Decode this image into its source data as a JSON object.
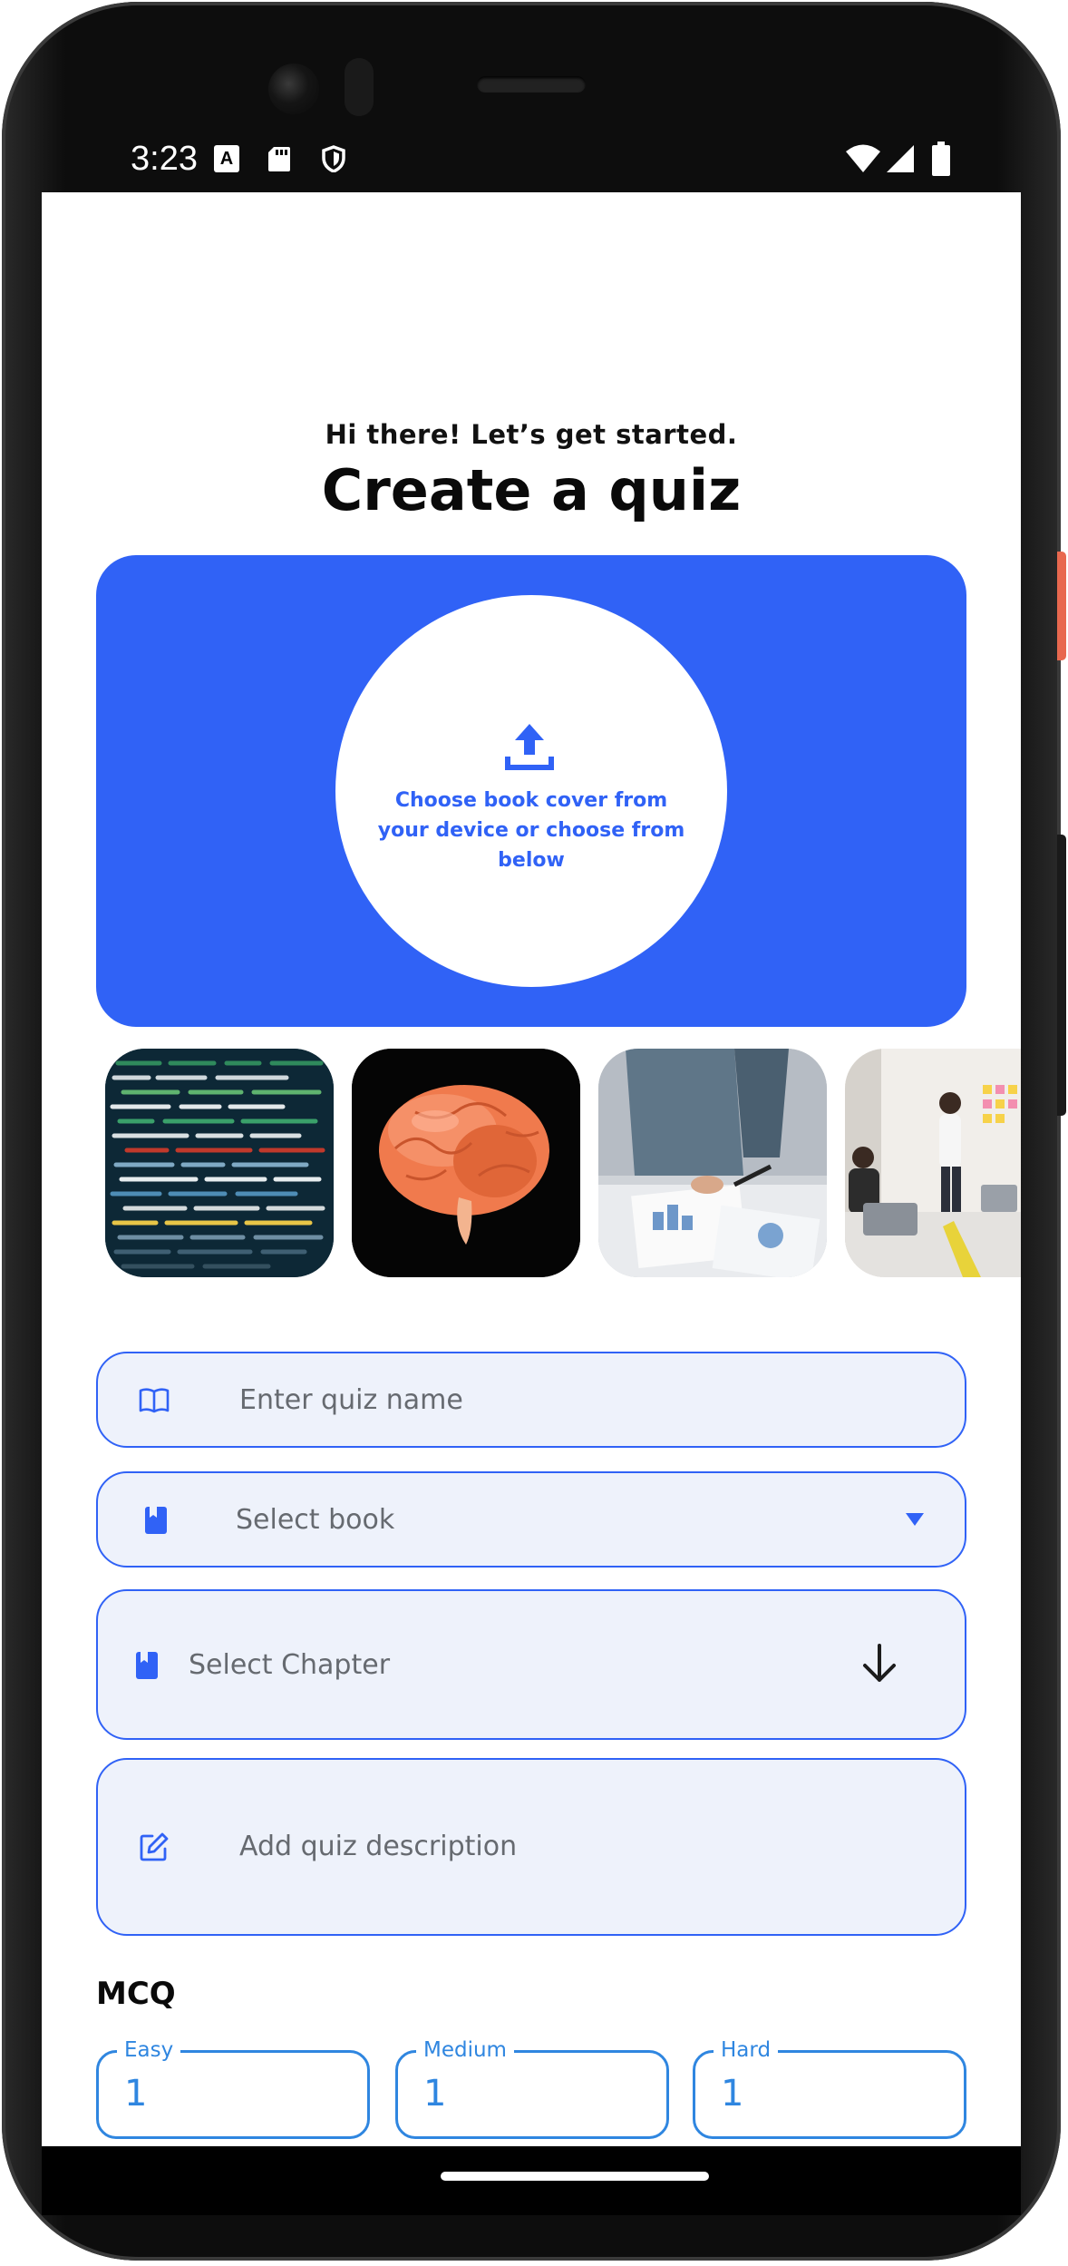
{
  "status_bar": {
    "time": "3:23",
    "icons": [
      "a-notification-icon",
      "sd-card-icon",
      "shield-icon",
      "wifi-icon",
      "signal-icon",
      "battery-icon"
    ]
  },
  "header": {
    "greeting": "Hi there! Let’s get started.",
    "title": "Create a quiz"
  },
  "cover_picker": {
    "icon": "upload-icon",
    "text": "Choose book cover from your device or choose from below",
    "color": "#3062f6"
  },
  "cover_options": [
    {
      "name": "code-screen-image"
    },
    {
      "name": "brain-image"
    },
    {
      "name": "meeting-charts-image"
    },
    {
      "name": "office-presentation-image"
    }
  ],
  "form": {
    "quiz_name": {
      "placeholder": "Enter quiz name",
      "icon": "book-open-icon"
    },
    "book": {
      "placeholder": "Select book",
      "icon": "book-icon"
    },
    "chapter": {
      "placeholder": "Select Chapter",
      "icon": "book-icon"
    },
    "description": {
      "placeholder": "Add quiz description",
      "icon": "edit-icon"
    }
  },
  "mcq": {
    "label": "MCQ",
    "levels": [
      {
        "label": "Easy",
        "value": "1"
      },
      {
        "label": "Medium",
        "value": "1"
      },
      {
        "label": "Hard",
        "value": "1"
      }
    ]
  }
}
